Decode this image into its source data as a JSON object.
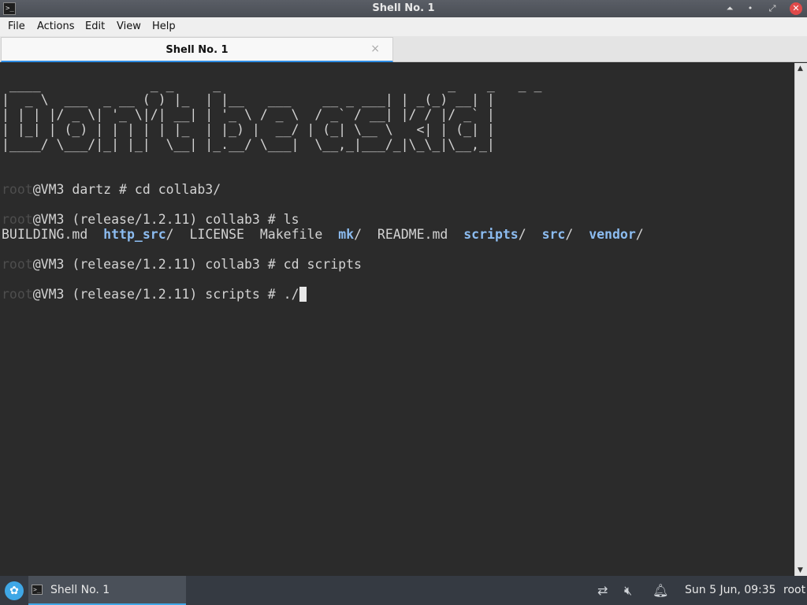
{
  "window": {
    "title": "Shell No. 1",
    "app_icon": ">_",
    "buttons": {
      "shade": "⏶",
      "minimize": "•",
      "maximize": "⤢",
      "close": "✕"
    }
  },
  "menu": {
    "file": "File",
    "actions": "Actions",
    "edit": "Edit",
    "view": "View",
    "help": "Help"
  },
  "tab": {
    "label": "Shell No. 1",
    "close": "×"
  },
  "terminal": {
    "banner": [
      " ____              _ _     _                             _    _   _ _ ",
      "|  _ \\  ___  _ __ ( ) |_  | |__   ___    __ _ ___| | _(_) __| |",
      "| | | |/ _ \\| '_ \\|/| __| | '_ \\ / _ \\  / _` / __| |/ / |/ _` |",
      "| |_| | (_) | | | | | |_  | |_) |  __/ | (_| \\__ \\   <| | (_| |",
      "|____/ \\___/|_| |_|  \\__| |_.__/ \\___|  \\__,_|___/_|\\_\\_|\\__,_|"
    ],
    "prompt_user": "root",
    "lines": [
      {
        "host": "@VM3 dartz # ",
        "cmd": "cd collab3/"
      },
      {
        "host": "@VM3 (release/1.2.11) collab3 # ",
        "cmd": "ls"
      },
      {
        "host": "@VM3 (release/1.2.11) collab3 # ",
        "cmd": "cd scripts"
      },
      {
        "host": "@VM3 (release/1.2.11) scripts # ",
        "cmd": "./"
      }
    ],
    "ls_output": [
      {
        "name": "BUILDING.md",
        "dir": false,
        "sep": ""
      },
      {
        "name": "http_src",
        "dir": true,
        "sep": "/"
      },
      {
        "name": "LICENSE",
        "dir": false,
        "sep": ""
      },
      {
        "name": "Makefile",
        "dir": false,
        "sep": ""
      },
      {
        "name": "mk",
        "dir": true,
        "sep": "/"
      },
      {
        "name": "README.md",
        "dir": false,
        "sep": ""
      },
      {
        "name": "scripts",
        "dir": true,
        "sep": "/"
      },
      {
        "name": "src",
        "dir": true,
        "sep": "/"
      },
      {
        "name": "vendor",
        "dir": true,
        "sep": "/"
      }
    ],
    "colors": {
      "background": "#2b2b2b",
      "text": "#d3d3d3",
      "dir": "#8cbcf0",
      "dim_user": "#4e4e4e"
    }
  },
  "taskbar": {
    "task_label": "Shell No. 1",
    "clock": "Sun  5 Jun, 09:35",
    "user": "root",
    "tray_icons": [
      "network-disconnected-icon",
      "volume-muted-icon",
      "notification-bell-icon"
    ]
  }
}
